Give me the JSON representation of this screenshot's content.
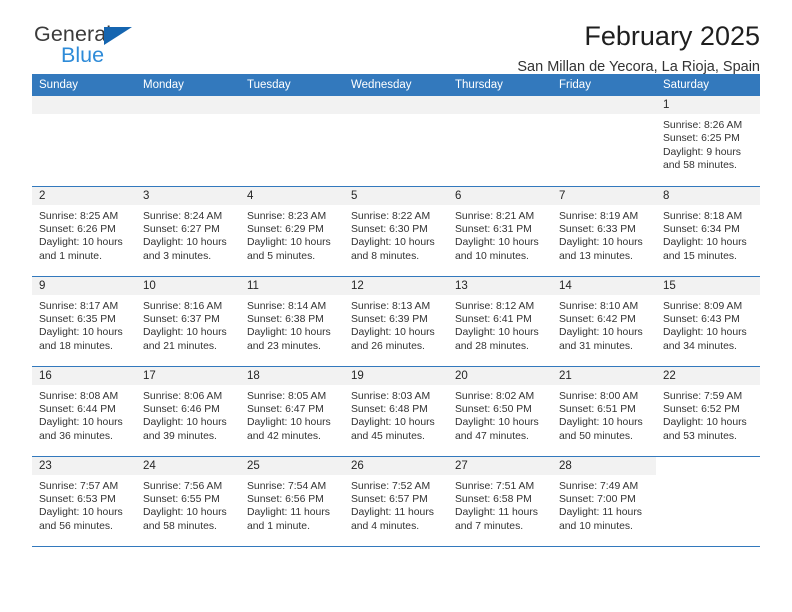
{
  "brand": {
    "name_dark": "General",
    "name_blue": "Blue",
    "triangle_color": "#1565b0",
    "blue_color": "#2e8bd8"
  },
  "header": {
    "title": "February 2025",
    "subtitle": "San Millan de Yecora, La Rioja, Spain"
  },
  "theme": {
    "header_bg": "#3379bd",
    "daynum_bg": "#f2f2f2",
    "rule_color": "#3379bd"
  },
  "weekdays": [
    "Sunday",
    "Monday",
    "Tuesday",
    "Wednesday",
    "Thursday",
    "Friday",
    "Saturday"
  ],
  "weeks": [
    [
      {
        "day": "",
        "empty": true
      },
      {
        "day": "",
        "empty": true
      },
      {
        "day": "",
        "empty": true
      },
      {
        "day": "",
        "empty": true
      },
      {
        "day": "",
        "empty": true
      },
      {
        "day": "",
        "empty": true
      },
      {
        "day": "1",
        "sunrise": "Sunrise: 8:26 AM",
        "sunset": "Sunset: 6:25 PM",
        "daylight": "Daylight: 9 hours and 58 minutes."
      }
    ],
    [
      {
        "day": "2",
        "sunrise": "Sunrise: 8:25 AM",
        "sunset": "Sunset: 6:26 PM",
        "daylight": "Daylight: 10 hours and 1 minute."
      },
      {
        "day": "3",
        "sunrise": "Sunrise: 8:24 AM",
        "sunset": "Sunset: 6:27 PM",
        "daylight": "Daylight: 10 hours and 3 minutes."
      },
      {
        "day": "4",
        "sunrise": "Sunrise: 8:23 AM",
        "sunset": "Sunset: 6:29 PM",
        "daylight": "Daylight: 10 hours and 5 minutes."
      },
      {
        "day": "5",
        "sunrise": "Sunrise: 8:22 AM",
        "sunset": "Sunset: 6:30 PM",
        "daylight": "Daylight: 10 hours and 8 minutes."
      },
      {
        "day": "6",
        "sunrise": "Sunrise: 8:21 AM",
        "sunset": "Sunset: 6:31 PM",
        "daylight": "Daylight: 10 hours and 10 minutes."
      },
      {
        "day": "7",
        "sunrise": "Sunrise: 8:19 AM",
        "sunset": "Sunset: 6:33 PM",
        "daylight": "Daylight: 10 hours and 13 minutes."
      },
      {
        "day": "8",
        "sunrise": "Sunrise: 8:18 AM",
        "sunset": "Sunset: 6:34 PM",
        "daylight": "Daylight: 10 hours and 15 minutes."
      }
    ],
    [
      {
        "day": "9",
        "sunrise": "Sunrise: 8:17 AM",
        "sunset": "Sunset: 6:35 PM",
        "daylight": "Daylight: 10 hours and 18 minutes."
      },
      {
        "day": "10",
        "sunrise": "Sunrise: 8:16 AM",
        "sunset": "Sunset: 6:37 PM",
        "daylight": "Daylight: 10 hours and 21 minutes."
      },
      {
        "day": "11",
        "sunrise": "Sunrise: 8:14 AM",
        "sunset": "Sunset: 6:38 PM",
        "daylight": "Daylight: 10 hours and 23 minutes."
      },
      {
        "day": "12",
        "sunrise": "Sunrise: 8:13 AM",
        "sunset": "Sunset: 6:39 PM",
        "daylight": "Daylight: 10 hours and 26 minutes."
      },
      {
        "day": "13",
        "sunrise": "Sunrise: 8:12 AM",
        "sunset": "Sunset: 6:41 PM",
        "daylight": "Daylight: 10 hours and 28 minutes."
      },
      {
        "day": "14",
        "sunrise": "Sunrise: 8:10 AM",
        "sunset": "Sunset: 6:42 PM",
        "daylight": "Daylight: 10 hours and 31 minutes."
      },
      {
        "day": "15",
        "sunrise": "Sunrise: 8:09 AM",
        "sunset": "Sunset: 6:43 PM",
        "daylight": "Daylight: 10 hours and 34 minutes."
      }
    ],
    [
      {
        "day": "16",
        "sunrise": "Sunrise: 8:08 AM",
        "sunset": "Sunset: 6:44 PM",
        "daylight": "Daylight: 10 hours and 36 minutes."
      },
      {
        "day": "17",
        "sunrise": "Sunrise: 8:06 AM",
        "sunset": "Sunset: 6:46 PM",
        "daylight": "Daylight: 10 hours and 39 minutes."
      },
      {
        "day": "18",
        "sunrise": "Sunrise: 8:05 AM",
        "sunset": "Sunset: 6:47 PM",
        "daylight": "Daylight: 10 hours and 42 minutes."
      },
      {
        "day": "19",
        "sunrise": "Sunrise: 8:03 AM",
        "sunset": "Sunset: 6:48 PM",
        "daylight": "Daylight: 10 hours and 45 minutes."
      },
      {
        "day": "20",
        "sunrise": "Sunrise: 8:02 AM",
        "sunset": "Sunset: 6:50 PM",
        "daylight": "Daylight: 10 hours and 47 minutes."
      },
      {
        "day": "21",
        "sunrise": "Sunrise: 8:00 AM",
        "sunset": "Sunset: 6:51 PM",
        "daylight": "Daylight: 10 hours and 50 minutes."
      },
      {
        "day": "22",
        "sunrise": "Sunrise: 7:59 AM",
        "sunset": "Sunset: 6:52 PM",
        "daylight": "Daylight: 10 hours and 53 minutes."
      }
    ],
    [
      {
        "day": "23",
        "sunrise": "Sunrise: 7:57 AM",
        "sunset": "Sunset: 6:53 PM",
        "daylight": "Daylight: 10 hours and 56 minutes."
      },
      {
        "day": "24",
        "sunrise": "Sunrise: 7:56 AM",
        "sunset": "Sunset: 6:55 PM",
        "daylight": "Daylight: 10 hours and 58 minutes."
      },
      {
        "day": "25",
        "sunrise": "Sunrise: 7:54 AM",
        "sunset": "Sunset: 6:56 PM",
        "daylight": "Daylight: 11 hours and 1 minute."
      },
      {
        "day": "26",
        "sunrise": "Sunrise: 7:52 AM",
        "sunset": "Sunset: 6:57 PM",
        "daylight": "Daylight: 11 hours and 4 minutes."
      },
      {
        "day": "27",
        "sunrise": "Sunrise: 7:51 AM",
        "sunset": "Sunset: 6:58 PM",
        "daylight": "Daylight: 11 hours and 7 minutes."
      },
      {
        "day": "28",
        "sunrise": "Sunrise: 7:49 AM",
        "sunset": "Sunset: 7:00 PM",
        "daylight": "Daylight: 11 hours and 10 minutes."
      },
      {
        "day": "",
        "blank": true
      }
    ]
  ]
}
